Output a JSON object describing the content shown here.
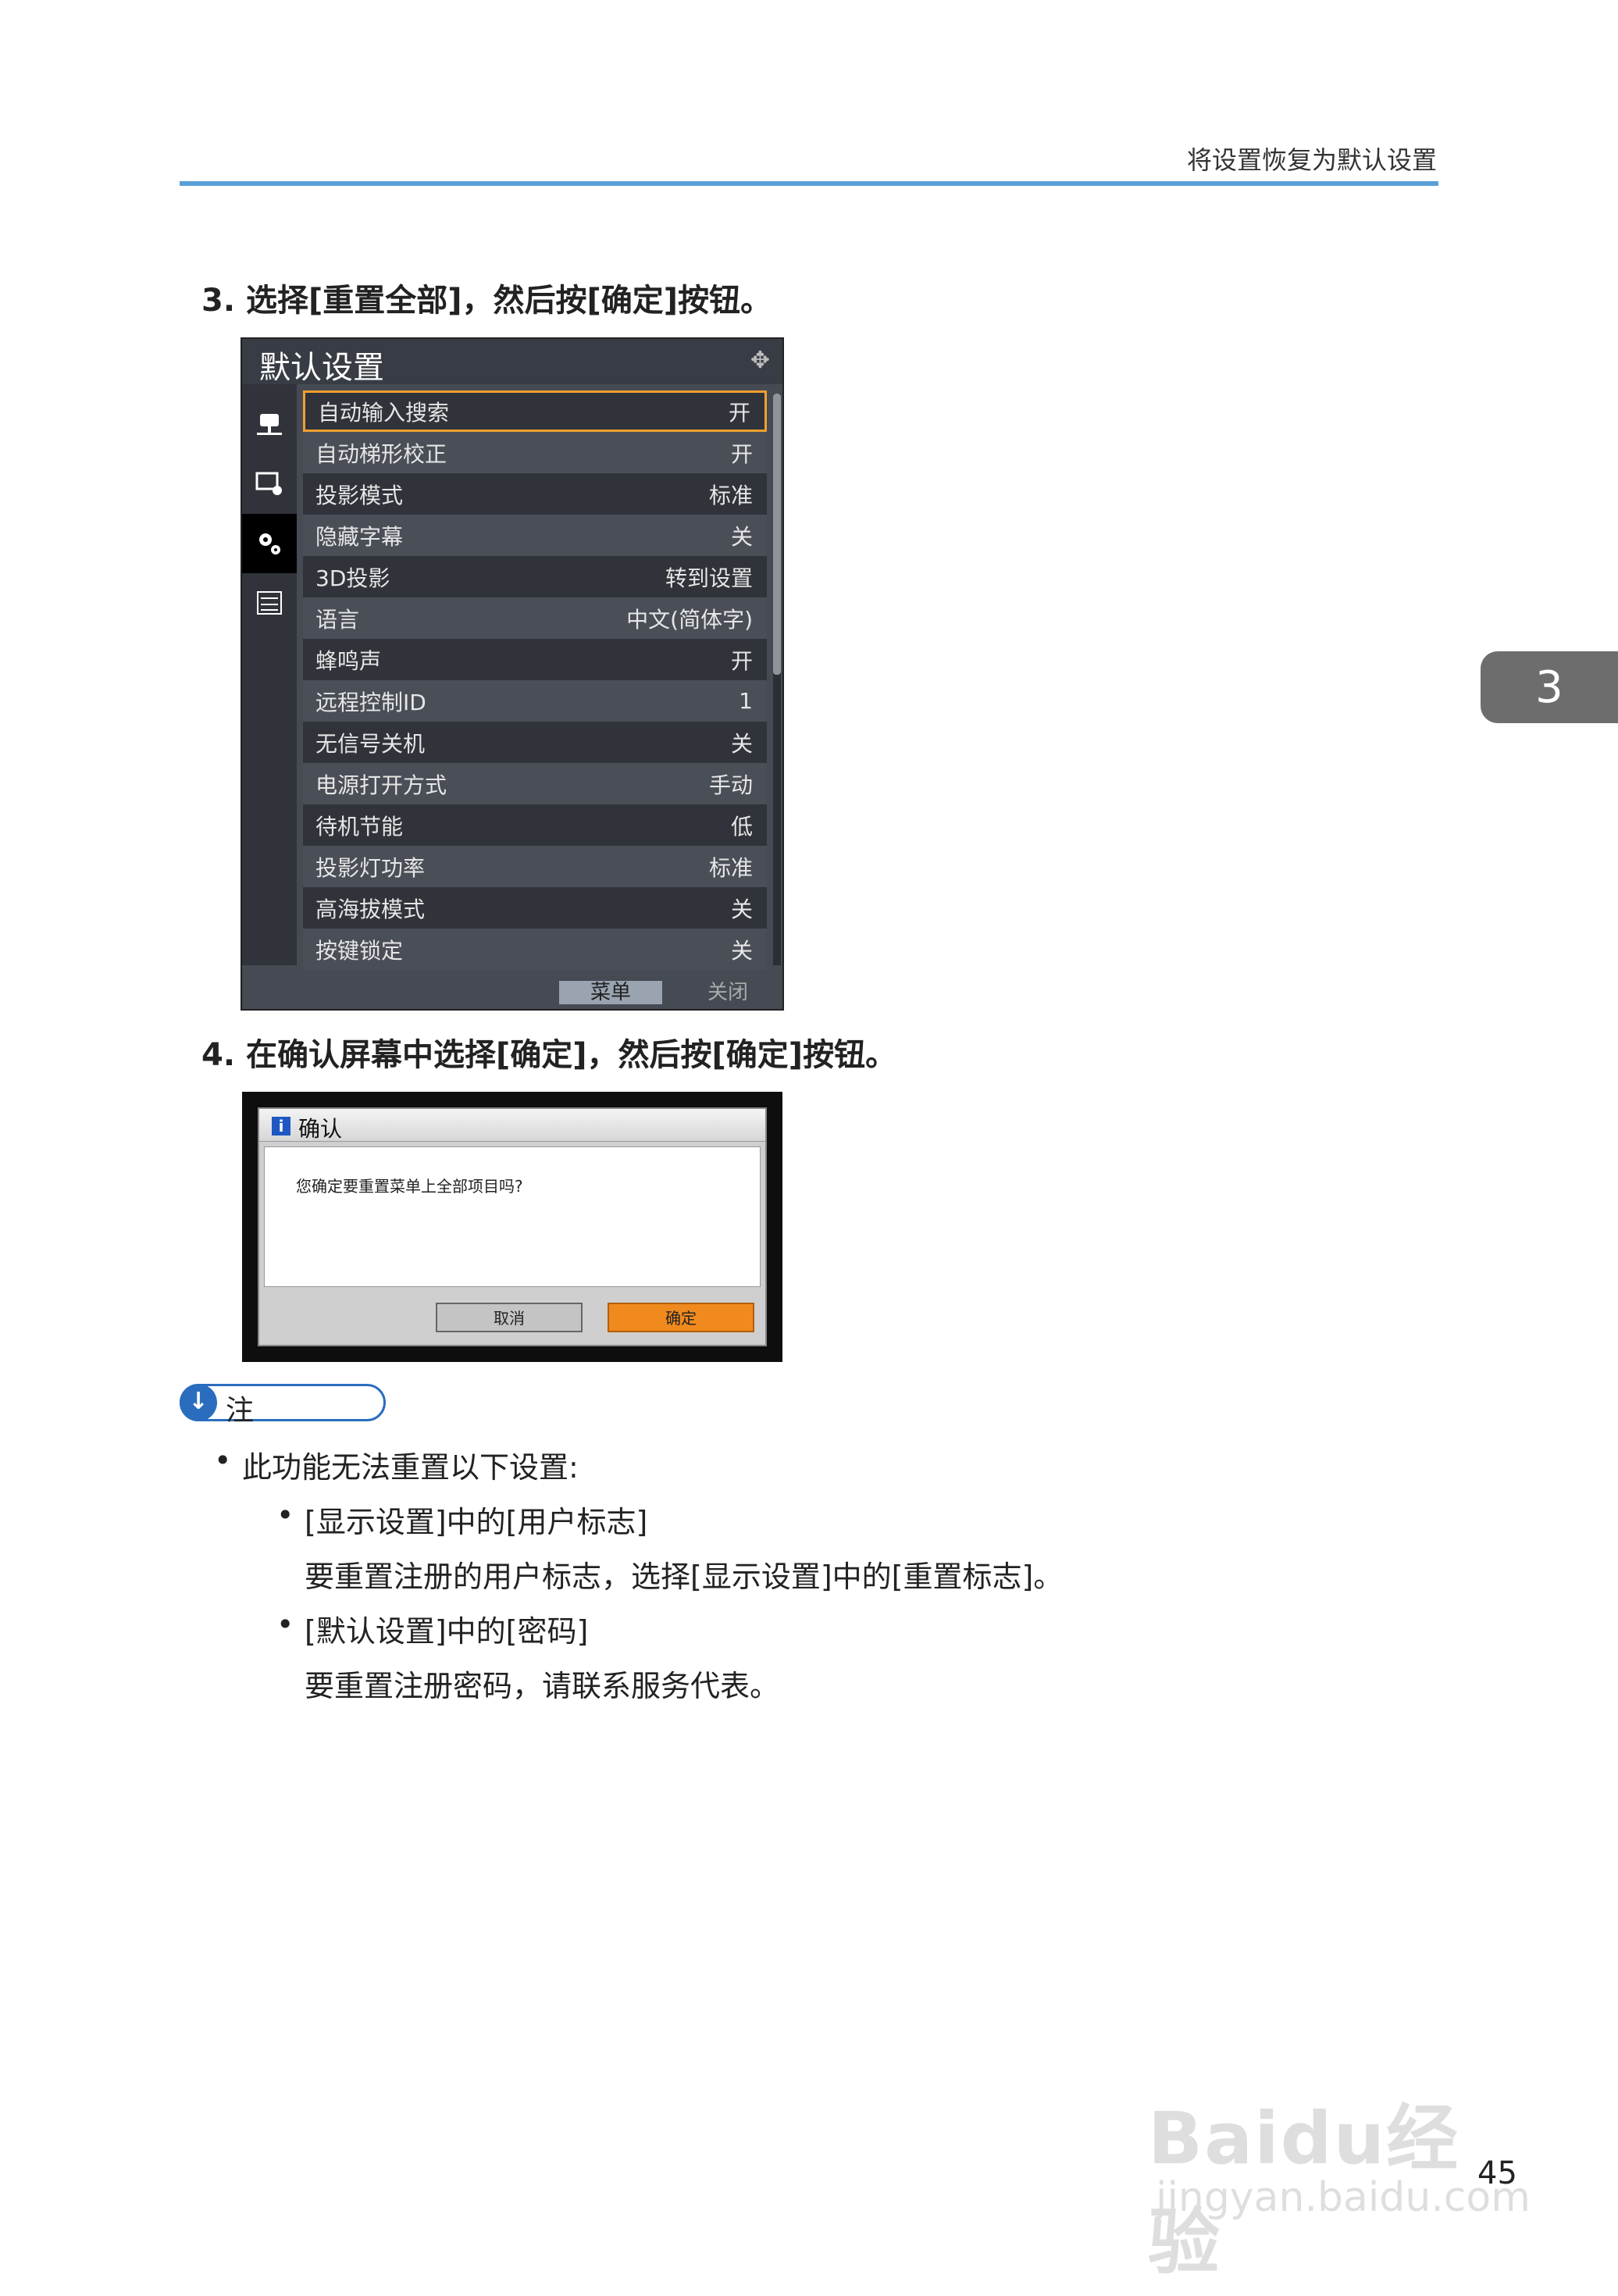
{
  "header": {
    "title": "将设置恢复为默认设置"
  },
  "chapter_tab": "3",
  "steps": [
    {
      "text": "3. 选择[重置全部]，然后按[确定]按钮。"
    },
    {
      "text": "4. 在确认屏幕中选择[确定]，然后按[确定]按钮。"
    }
  ],
  "osd": {
    "title": "默认设置",
    "rows": [
      {
        "label": "自动输入搜索",
        "value": "开"
      },
      {
        "label": "自动梯形校正",
        "value": "开"
      },
      {
        "label": "投影模式",
        "value": "标准"
      },
      {
        "label": "隐藏字幕",
        "value": "关"
      },
      {
        "label": "3D投影",
        "value": "转到设置"
      },
      {
        "label": "语言",
        "value": "中文(简体字)"
      },
      {
        "label": "蜂鸣声",
        "value": "开"
      },
      {
        "label": "远程控制ID",
        "value": "1"
      },
      {
        "label": "无信号关机",
        "value": "关"
      },
      {
        "label": "电源打开方式",
        "value": "手动"
      },
      {
        "label": "待机节能",
        "value": "低"
      },
      {
        "label": "投影灯功率",
        "value": "标准"
      },
      {
        "label": "高海拔模式",
        "value": "关"
      },
      {
        "label": "按键锁定",
        "value": "关"
      }
    ],
    "footer": {
      "menu": "菜单",
      "close": "关闭"
    }
  },
  "dialog": {
    "title": "确认",
    "message": "您确定要重置菜单上全部项目吗?",
    "cancel": "取消",
    "ok": "确定"
  },
  "note": {
    "label": "注",
    "intro": "此功能无法重置以下设置:",
    "items": [
      {
        "title": "[显示设置]中的[用户标志]",
        "detail": "要重置注册的用户标志，选择[显示设置]中的[重置标志]。"
      },
      {
        "title": "[默认设置]中的[密码]",
        "detail": "要重置注册密码，请联系服务代表。"
      }
    ]
  },
  "page_number": "45",
  "watermark": {
    "main": "Baidu经验",
    "sub": "jingyan.baidu.com"
  }
}
